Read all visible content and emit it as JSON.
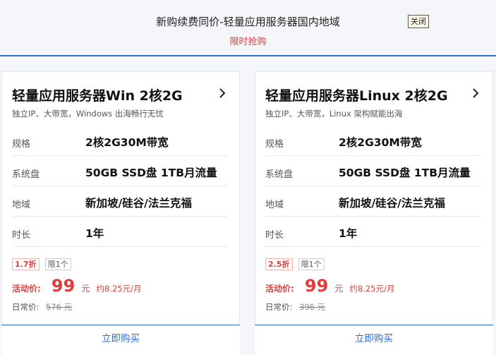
{
  "banner": {
    "title": "新购续费同价-轻量应用服务器国内地域",
    "subtitle": "限时抢购",
    "close_label": "关闭"
  },
  "colors": {
    "accent": "#2b6fd6",
    "price_red": "#e03c3c"
  },
  "cards": [
    {
      "title": "轻量应用服务器Win 2核2G",
      "desc": "独立IP、大带宽，Windows 出海畅行无忧",
      "specs": [
        {
          "key": "规格",
          "value": "2核2G30M带宽"
        },
        {
          "key": "系统盘",
          "value": "50GB SSD盘 1TB月流量"
        },
        {
          "key": "地域",
          "value": "新加坡/硅谷/法兰克福"
        },
        {
          "key": "时长",
          "value": "1年"
        }
      ],
      "discount_tag": "1.7折",
      "limit_tag": "限1个",
      "price_label": "活动价:",
      "price": "99",
      "price_unit": "元",
      "price_per": "约8.25元/月",
      "orig_label": "日常价:",
      "orig_price": "576 元",
      "buy_label": "立即购买"
    },
    {
      "title": "轻量应用服务器Linux 2核2G",
      "desc": "独立IP、大带宽，Linux 架构赋能出海",
      "specs": [
        {
          "key": "规格",
          "value": "2核2G30M带宽"
        },
        {
          "key": "系统盘",
          "value": "50GB SSD盘 1TB月流量"
        },
        {
          "key": "地域",
          "value": "新加坡/硅谷/法兰克福"
        },
        {
          "key": "时长",
          "value": "1年"
        }
      ],
      "discount_tag": "2.5折",
      "limit_tag": "限1个",
      "price_label": "活动价:",
      "price": "99",
      "price_unit": "元",
      "price_per": "约8.25元/月",
      "orig_label": "日常价:",
      "orig_price": "396 元",
      "buy_label": "立即购买"
    }
  ]
}
